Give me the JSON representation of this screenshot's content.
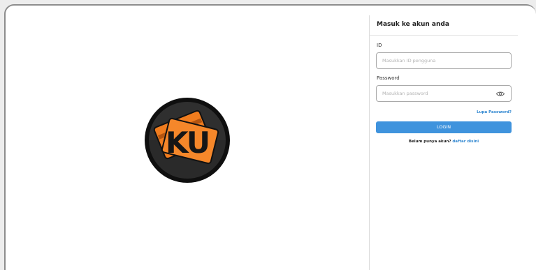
{
  "branding": {
    "logo_text": "KU",
    "colors": {
      "logo_ring": "#111111",
      "logo_card": "#f07c1e",
      "accent": "#3f93dd",
      "link": "#2f86d0"
    }
  },
  "login_panel": {
    "title": "Masuk ke akun anda",
    "id_field": {
      "label": "ID",
      "value": "",
      "placeholder": "Masukkan ID pengguna"
    },
    "password_field": {
      "label": "Password",
      "value": "",
      "placeholder": "Masukkan password",
      "toggle_icon": "eye-icon"
    },
    "forgot_password": "Lupa Password?",
    "login_button": "LOGIN",
    "signup": {
      "text": "Belum punya akun?",
      "link": "daftar disini"
    }
  }
}
